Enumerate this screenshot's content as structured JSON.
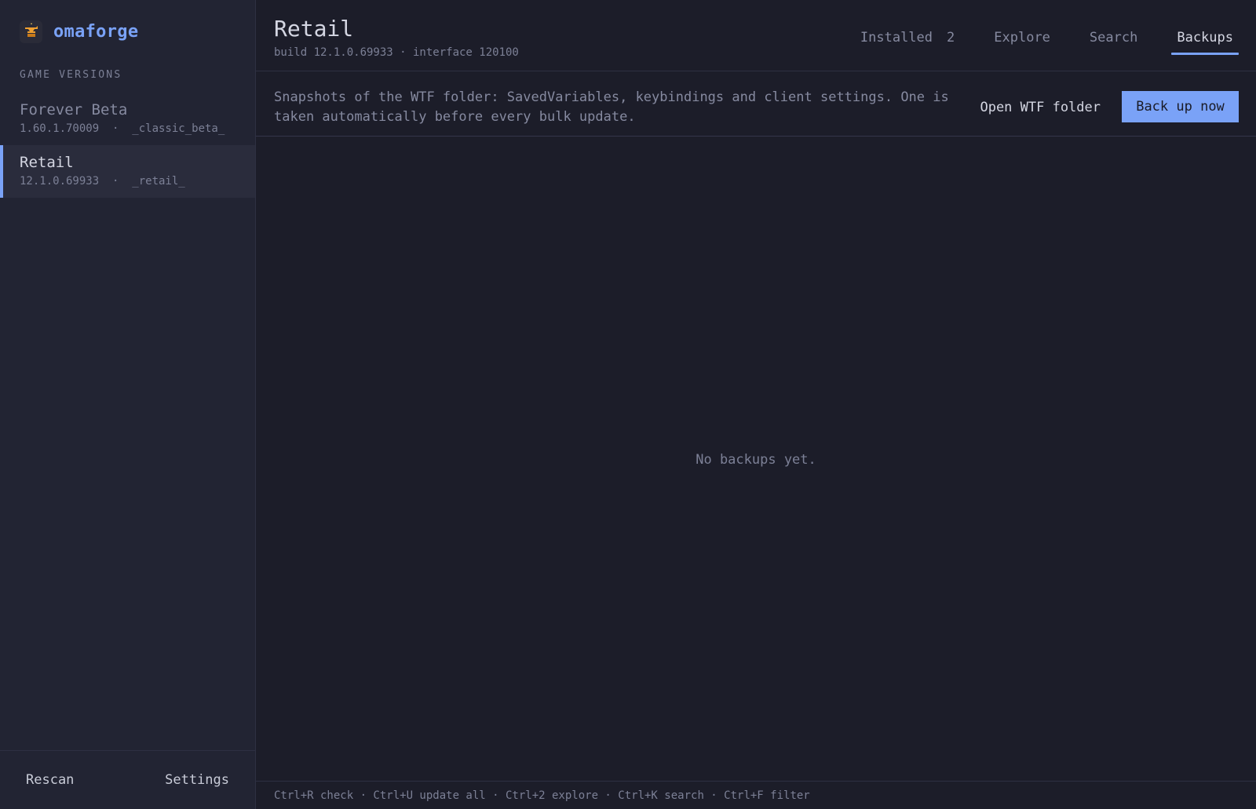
{
  "app": {
    "name": "omaforge",
    "logo_icon": "anvil-icon",
    "accent_color": "#7aa2f7"
  },
  "sidebar": {
    "section_label": "GAME VERSIONS",
    "versions": [
      {
        "name": "Forever Beta",
        "meta": "1.60.1.70009  ·  _classic_beta_",
        "active": false
      },
      {
        "name": "Retail",
        "meta": "12.1.0.69933  ·  _retail_",
        "active": true
      }
    ],
    "footer": {
      "rescan_label": "Rescan",
      "settings_label": "Settings"
    }
  },
  "header": {
    "title": "Retail",
    "subtitle": "build 12.1.0.69933 · interface 120100",
    "tabs": [
      {
        "label": "Installed",
        "count": "2",
        "active": false
      },
      {
        "label": "Explore",
        "active": false
      },
      {
        "label": "Search",
        "active": false
      },
      {
        "label": "Backups",
        "active": true
      }
    ]
  },
  "backups": {
    "description": "Snapshots of the WTF folder: SavedVariables, keybindings and client settings. One is taken automatically before every bulk update.",
    "open_folder_label": "Open WTF folder",
    "backup_now_label": "Back up now",
    "empty_message": "No backups yet."
  },
  "status_bar": {
    "shortcuts": "Ctrl+R check · Ctrl+U update all · Ctrl+2 explore · Ctrl+K search · Ctrl+F filter"
  }
}
